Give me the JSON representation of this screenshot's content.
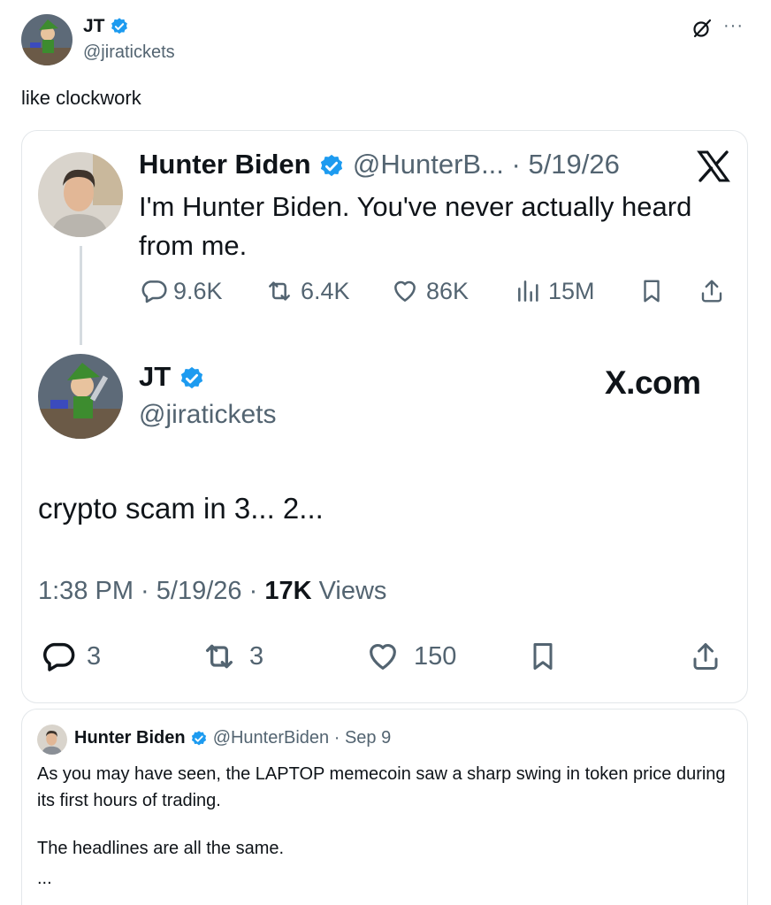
{
  "post": {
    "author_name": "JT",
    "author_handle": "@jiratickets",
    "text": "like clockwork",
    "more_label": "···"
  },
  "screenshot": {
    "original": {
      "author_name": "Hunter Biden",
      "meta": "@HunterB... · 5/19/26",
      "text": "I'm Hunter Biden. You've never actually heard from me.",
      "stats": {
        "replies": "9.6K",
        "reposts": "6.4K",
        "likes": "86K",
        "views": "15M"
      }
    },
    "reply": {
      "author_name": "JT",
      "author_handle": "@jiratickets",
      "brand": "X.com",
      "text": "crypto scam in 3... 2...",
      "timestamp": "1:38 PM · 5/19/26 · ",
      "views_count": "17K",
      "views_label": " Views",
      "stats": {
        "replies": "3",
        "reposts": "3",
        "likes": "150"
      }
    }
  },
  "quoted": {
    "author_name": "Hunter Biden",
    "meta": "@HunterBiden · Sep 9",
    "text": "As you may have seen, the LAPTOP memecoin saw a sharp swing in token price during its first hours of trading.",
    "text2": "The headlines are all the same.",
    "ellipsis": "..."
  },
  "colors": {
    "verified": "#1d9bf0",
    "secondary_text": "#536471",
    "border": "#e3e7ea"
  }
}
